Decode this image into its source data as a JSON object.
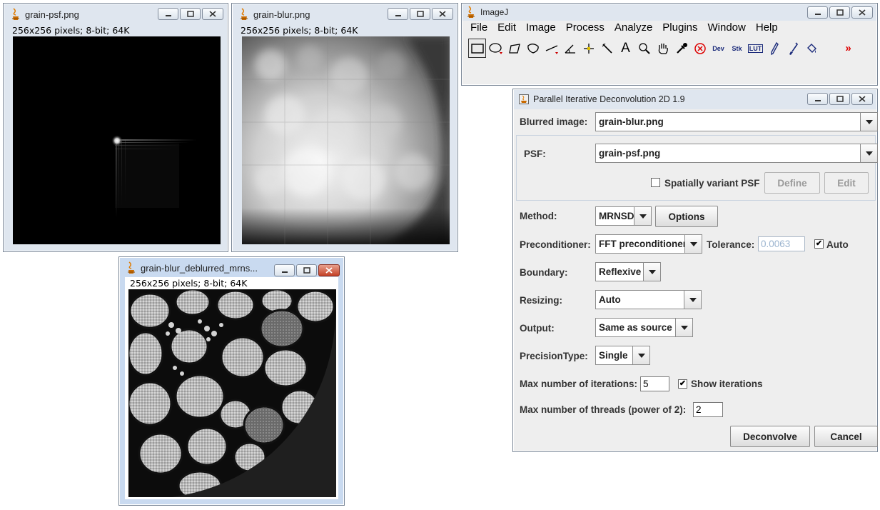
{
  "windows": {
    "psf": {
      "title": "grain-psf.png",
      "info": "256x256 pixels; 8-bit; 64K"
    },
    "blur": {
      "title": "grain-blur.png",
      "info": "256x256 pixels; 8-bit; 64K"
    },
    "deblurred": {
      "title": "grain-blur_deblurred_mrns...",
      "info": "256x256 pixels; 8-bit; 64K"
    },
    "imagej": {
      "title": "ImageJ",
      "menu": [
        "File",
        "Edit",
        "Image",
        "Process",
        "Analyze",
        "Plugins",
        "Window",
        "Help"
      ],
      "tools": [
        "rectangle-tool-icon",
        "oval-tool-icon",
        "polygon-tool-icon",
        "freehand-tool-icon",
        "line-tool-icon",
        "angle-tool-icon",
        "point-tool-icon",
        "wand-tool-icon",
        "text-tool-icon",
        "magnifier-tool-icon",
        "hand-tool-icon",
        "dropper-tool-icon",
        "stop-icon",
        "dev-menu-icon",
        "stk-menu-icon",
        "lut-menu-icon",
        "pencil-tool-icon",
        "brush-tool-icon",
        "flood-fill-icon",
        "more-tools-icon"
      ],
      "tool_texts": {
        "text": "A",
        "dev": "Dev",
        "stk": "Stk",
        "lut": "LUT",
        "more": "»"
      }
    }
  },
  "dialog": {
    "title": "Parallel Iterative Deconvolution 2D 1.9",
    "blurred_label": "Blurred image:",
    "blurred_value": "grain-blur.png",
    "psf_label": "PSF:",
    "psf_value": "grain-psf.png",
    "spatially_variant_label": "Spatially variant PSF",
    "spatially_variant_checked": false,
    "define_label": "Define",
    "edit_label": "Edit",
    "method_label": "Method:",
    "method_value": "MRNSD",
    "options_label": "Options",
    "preconditioner_label": "Preconditioner:",
    "preconditioner_value": "FFT preconditioner",
    "tolerance_label": "Tolerance:",
    "tolerance_value": "0.0063",
    "auto_label": "Auto",
    "auto_checked": true,
    "boundary_label": "Boundary:",
    "boundary_value": "Reflexive",
    "resizing_label": "Resizing:",
    "resizing_value": "Auto",
    "output_label": "Output:",
    "output_value": "Same as source",
    "precision_label": "PrecisionType:",
    "precision_value": "Single",
    "max_iter_label": "Max number of iterations:",
    "max_iter_value": "5",
    "show_iter_label": "Show iterations",
    "show_iter_checked": true,
    "max_threads_label": "Max number of threads (power of 2):",
    "max_threads_value": "2",
    "deconvolve_label": "Deconvolve",
    "cancel_label": "Cancel",
    "check_mark": "✔"
  },
  "colors": {
    "window_frame": "#dfe6ef",
    "dialog_bg": "#eeeeee",
    "close_red": "#c44127",
    "java_orange": "#e07b00"
  }
}
